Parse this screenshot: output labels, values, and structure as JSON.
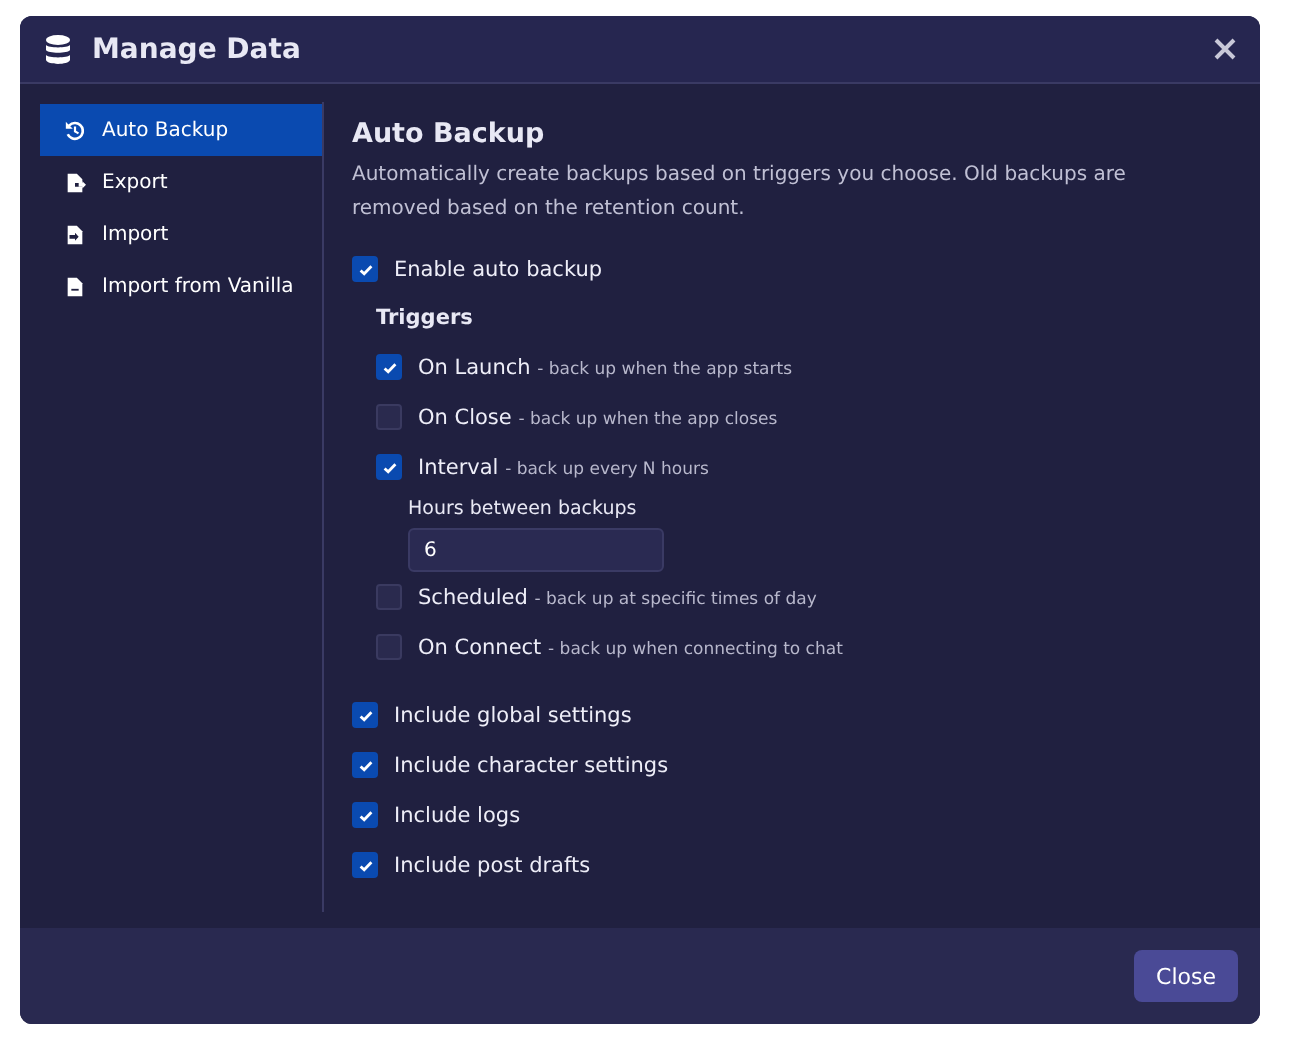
{
  "dialog": {
    "title": "Manage Data"
  },
  "sidebar": {
    "items": [
      {
        "label": "Auto Backup",
        "selected": true
      },
      {
        "label": "Export",
        "selected": false
      },
      {
        "label": "Import",
        "selected": false
      },
      {
        "label": "Import from Vanilla",
        "selected": false
      }
    ]
  },
  "content": {
    "title": "Auto Backup",
    "description": "Automatically create backups based on triggers you choose. Old backups are removed based on the retention count.",
    "enable": {
      "label": "Enable auto backup",
      "checked": true
    },
    "triggers_heading": "Triggers",
    "triggers": [
      {
        "label": "On Launch",
        "hint": "- back up when the app starts",
        "checked": true
      },
      {
        "label": "On Close",
        "hint": "- back up when the app closes",
        "checked": false
      },
      {
        "label": "Interval",
        "hint": "- back up every N hours",
        "checked": true,
        "field": {
          "label": "Hours between backups",
          "value": "6"
        }
      },
      {
        "label": "Scheduled",
        "hint": "- back up at specific times of day",
        "checked": false
      },
      {
        "label": "On Connect",
        "hint": "- back up when connecting to chat",
        "checked": false
      }
    ],
    "includes": [
      {
        "label": "Include global settings",
        "checked": true
      },
      {
        "label": "Include character settings",
        "checked": true
      },
      {
        "label": "Include logs",
        "checked": true
      },
      {
        "label": "Include post drafts",
        "checked": true
      }
    ]
  },
  "footer": {
    "button": "Close"
  }
}
